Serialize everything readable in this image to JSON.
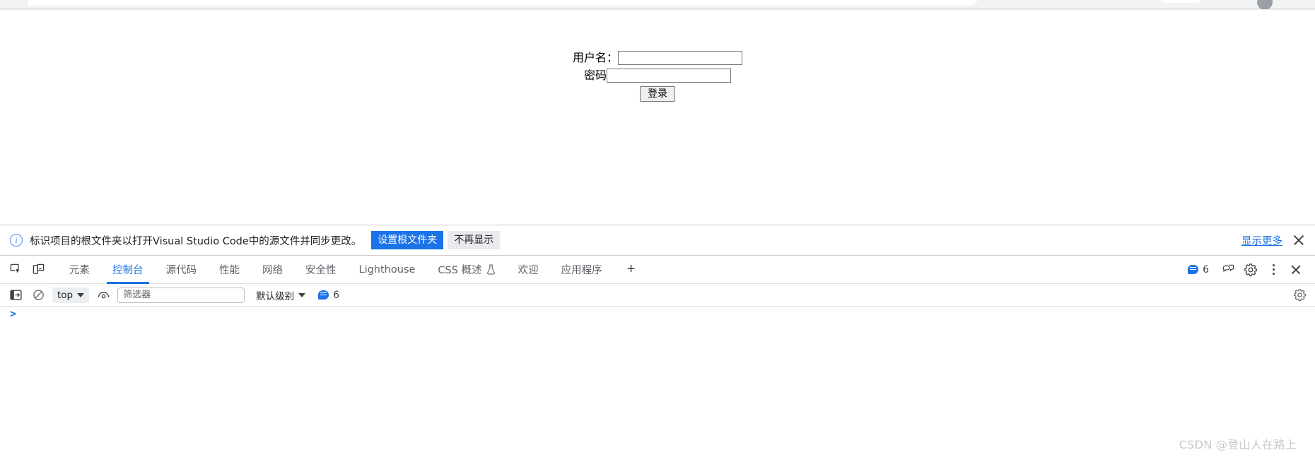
{
  "page": {
    "form": {
      "username_label": "用户名：",
      "username_value": "",
      "password_label": "密码",
      "password_value": "",
      "submit_label": "登录"
    }
  },
  "info_banner": {
    "icon": "info-circle-icon",
    "message": "标识项目的根文件夹以打开Visual Studio Code中的源文件并同步更改。",
    "primary_button": "设置根文件夹",
    "secondary_button": "不再显示",
    "show_more_link": "显示更多",
    "close_icon": "close-icon",
    "primary_color": "#1a73e8"
  },
  "devtools": {
    "left_icons": [
      {
        "name": "inspect-element-icon"
      },
      {
        "name": "device-toolbar-icon"
      }
    ],
    "tabs": [
      {
        "label": "元素",
        "active": false,
        "icon": null
      },
      {
        "label": "控制台",
        "active": true,
        "icon": null
      },
      {
        "label": "源代码",
        "active": false,
        "icon": null
      },
      {
        "label": "性能",
        "active": false,
        "icon": null
      },
      {
        "label": "网络",
        "active": false,
        "icon": null
      },
      {
        "label": "安全性",
        "active": false,
        "icon": null
      },
      {
        "label": "Lighthouse",
        "active": false,
        "icon": null
      },
      {
        "label": "CSS 概述",
        "active": false,
        "icon": "experiment-flask-icon"
      },
      {
        "label": "欢迎",
        "active": false,
        "icon": null
      },
      {
        "label": "应用程序",
        "active": false,
        "icon": null
      }
    ],
    "add_tab_label": "+",
    "header_right": {
      "message_count": "6",
      "message_icon": "message-bubble-icon",
      "feedback_icon": "feedback-icon",
      "settings_icon": "gear-icon",
      "more_icon": "kebab-menu-icon",
      "close_icon": "close-icon"
    },
    "active_tab_accent": "#1a73e8"
  },
  "console_toolbar": {
    "sidebar_icon": "console-sidebar-icon",
    "clear_icon": "clear-console-icon",
    "context": "top",
    "context_caret": "chevron-down-icon",
    "eye_icon": "live-expression-icon",
    "filter_placeholder": "筛选器",
    "filter_value": "",
    "level_label": "默认级别",
    "level_caret": "chevron-down-icon",
    "message_icon": "message-bubble-icon",
    "message_count": "6",
    "settings_icon": "gear-icon"
  },
  "console_body": {
    "prompt": ">",
    "input_value": ""
  },
  "watermark": "CSDN @登山人在路上"
}
